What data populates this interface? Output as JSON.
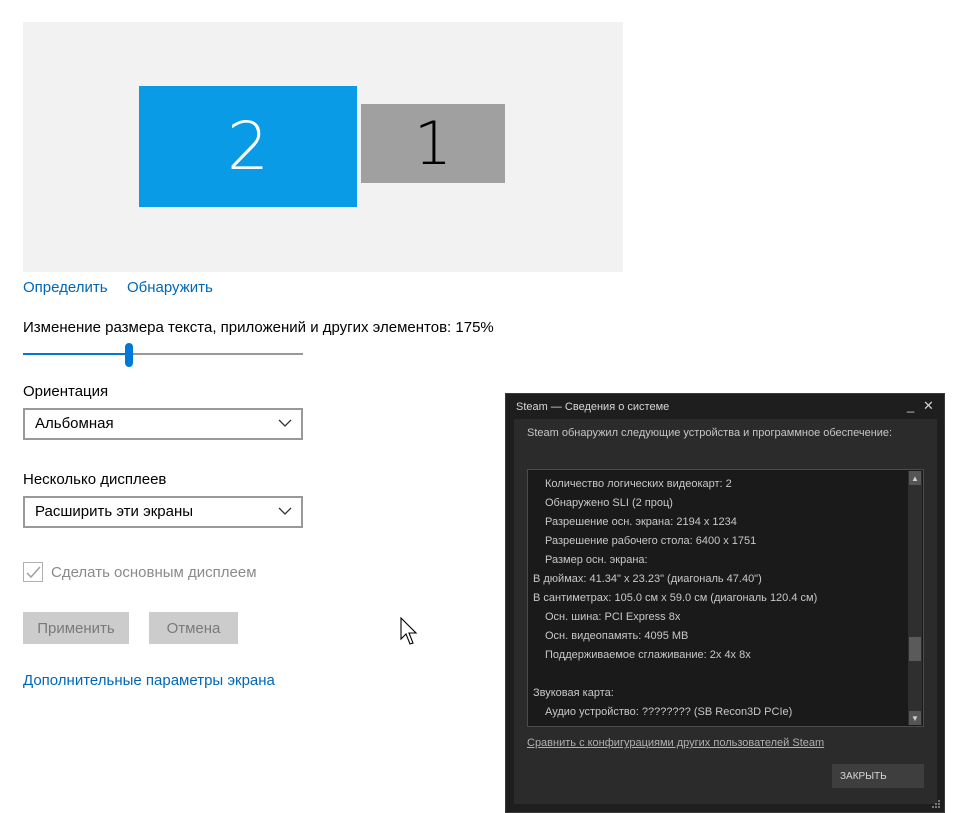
{
  "monitors": {
    "secondary_number": "2",
    "primary_number": "1"
  },
  "links": {
    "identify": "Определить",
    "detect": "Обнаружить",
    "advanced": "Дополнительные параметры экрана"
  },
  "scale": {
    "label": "Изменение размера текста, приложений и других элементов: 175%",
    "value_percent": 175,
    "slider_fraction": 0.38
  },
  "orientation": {
    "label": "Ориентация",
    "value": "Альбомная"
  },
  "multi_display": {
    "label": "Несколько дисплеев",
    "value": "Расширить эти экраны"
  },
  "main_display": {
    "label": "Сделать основным дисплеем",
    "checked": true
  },
  "buttons": {
    "apply": "Применить",
    "cancel": "Отмена"
  },
  "steam": {
    "title": "Steam — Сведения о системе",
    "minimize": "_",
    "close": "✕",
    "intro": "Steam обнаружил следующие устройства и программное обеспечение:",
    "lines": [
      "Количество логических видеокарт:  2",
      "Обнаружено SLI (2 проц)",
      "Разрешение осн. экрана:  2194 x 1234",
      "Разрешение рабочего стола: 6400 x 1751",
      "Размер осн. экрана:",
      "В дюймах: 41.34\" x 23.23\" (диагональ 47.40\")",
      "В сантиметрах: 105.0 см x 59.0 см (диагональ 120.4 см)",
      "Осн. шина: PCI Express 8x",
      "Осн. видеопамять: 4095 MB",
      "Поддерживаемое сглаживание:  2x 4x 8x",
      "",
      "Звуковая карта:",
      "Аудио устройство: ???????? (SB Recon3D PCIe)"
    ],
    "compare_link": "Сравнить с конфигурациями других пользователей Steam",
    "close_button": "ЗАКРЫТЬ"
  }
}
